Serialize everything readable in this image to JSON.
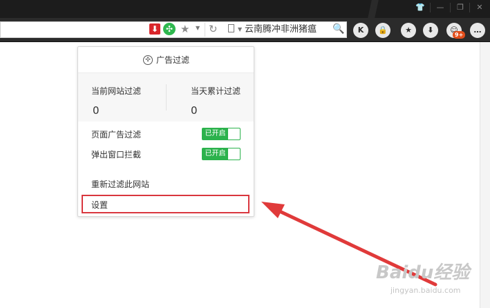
{
  "toolbar": {
    "search_text": "云南腾冲非洲猪瘟",
    "buttons": [
      {
        "name": "k-extension-button",
        "label": "K"
      },
      {
        "name": "lock-button",
        "label": "🔒"
      },
      {
        "name": "favorites-button",
        "label": "★"
      },
      {
        "name": "download-button",
        "label": "⬇"
      },
      {
        "name": "game-button",
        "label": "☺"
      },
      {
        "name": "menu-button",
        "label": "…"
      }
    ],
    "badge": "9+"
  },
  "popup": {
    "title": "广告过滤",
    "stats": {
      "current_site_label": "当前网站过滤",
      "current_site_value": "0",
      "today_label": "当天累计过滤",
      "today_value": "0"
    },
    "rows": [
      {
        "label": "页面广告过滤",
        "status": "已开启"
      },
      {
        "label": "弹出窗口拦截",
        "status": "已开启"
      }
    ],
    "actions": {
      "refilter": "重新过滤此网站",
      "settings": "设置"
    }
  },
  "watermark": {
    "logo": "Baidu经验",
    "url": "jingyan.baidu.com"
  },
  "colors": {
    "accent_green": "#2bb24c",
    "highlight_red": "#d9363e"
  }
}
